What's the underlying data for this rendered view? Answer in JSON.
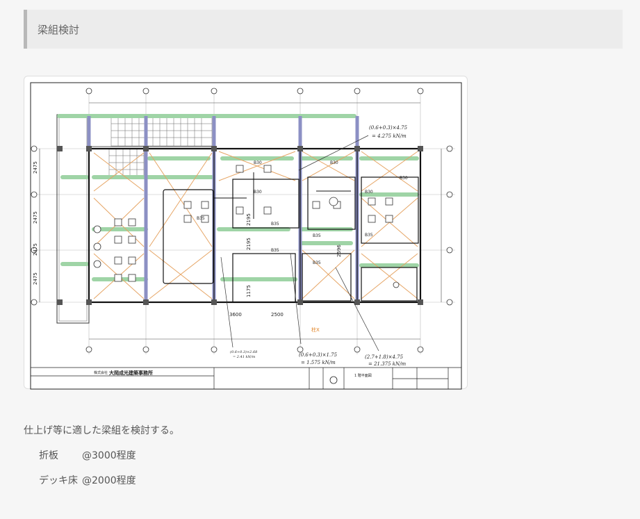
{
  "heading": {
    "title": "梁組検討"
  },
  "drawing": {
    "company_prefix": "株式会社",
    "company_name": "大岡成光建築事務所",
    "sheet_title": "1 階平面図",
    "beam_labels": [
      "B30",
      "B30",
      "B30",
      "B30",
      "B35",
      "B35",
      "B35",
      "B35",
      "B35",
      "B35",
      "B30"
    ],
    "dims_vertical": [
      "2475",
      "2475",
      "2475",
      "2475"
    ],
    "dims_horizontal": [
      "3600",
      "2500",
      "2195",
      "2195",
      "1175",
      "2596"
    ],
    "note_top": "(0.6+0.3)×4.75",
    "note_top_result": "= 4.275 kN/m",
    "note_left": "(0.6+0.3)×2.68",
    "note_left_result": "= 2.41 kN/m",
    "note_mid": "(0.6+0.3)×1.75",
    "note_mid_result": "= 1.575 kN/m",
    "note_right": "(2.7+1.8)×4.75",
    "note_right_result": "= 21.375 kN/m",
    "tag_orange": "柱X"
  },
  "body": {
    "caption": "仕上げ等に適した梁組を検討する。",
    "specs": [
      {
        "label": "折板",
        "value": "@3000程度"
      },
      {
        "label": "デッキ床",
        "value": "@2000程度"
      }
    ]
  },
  "colors": {
    "beam_green": "#9fd4a6",
    "beam_purple": "#8c90c4",
    "cross_orange": "#e6a565",
    "ink": "#1a1a1a"
  }
}
